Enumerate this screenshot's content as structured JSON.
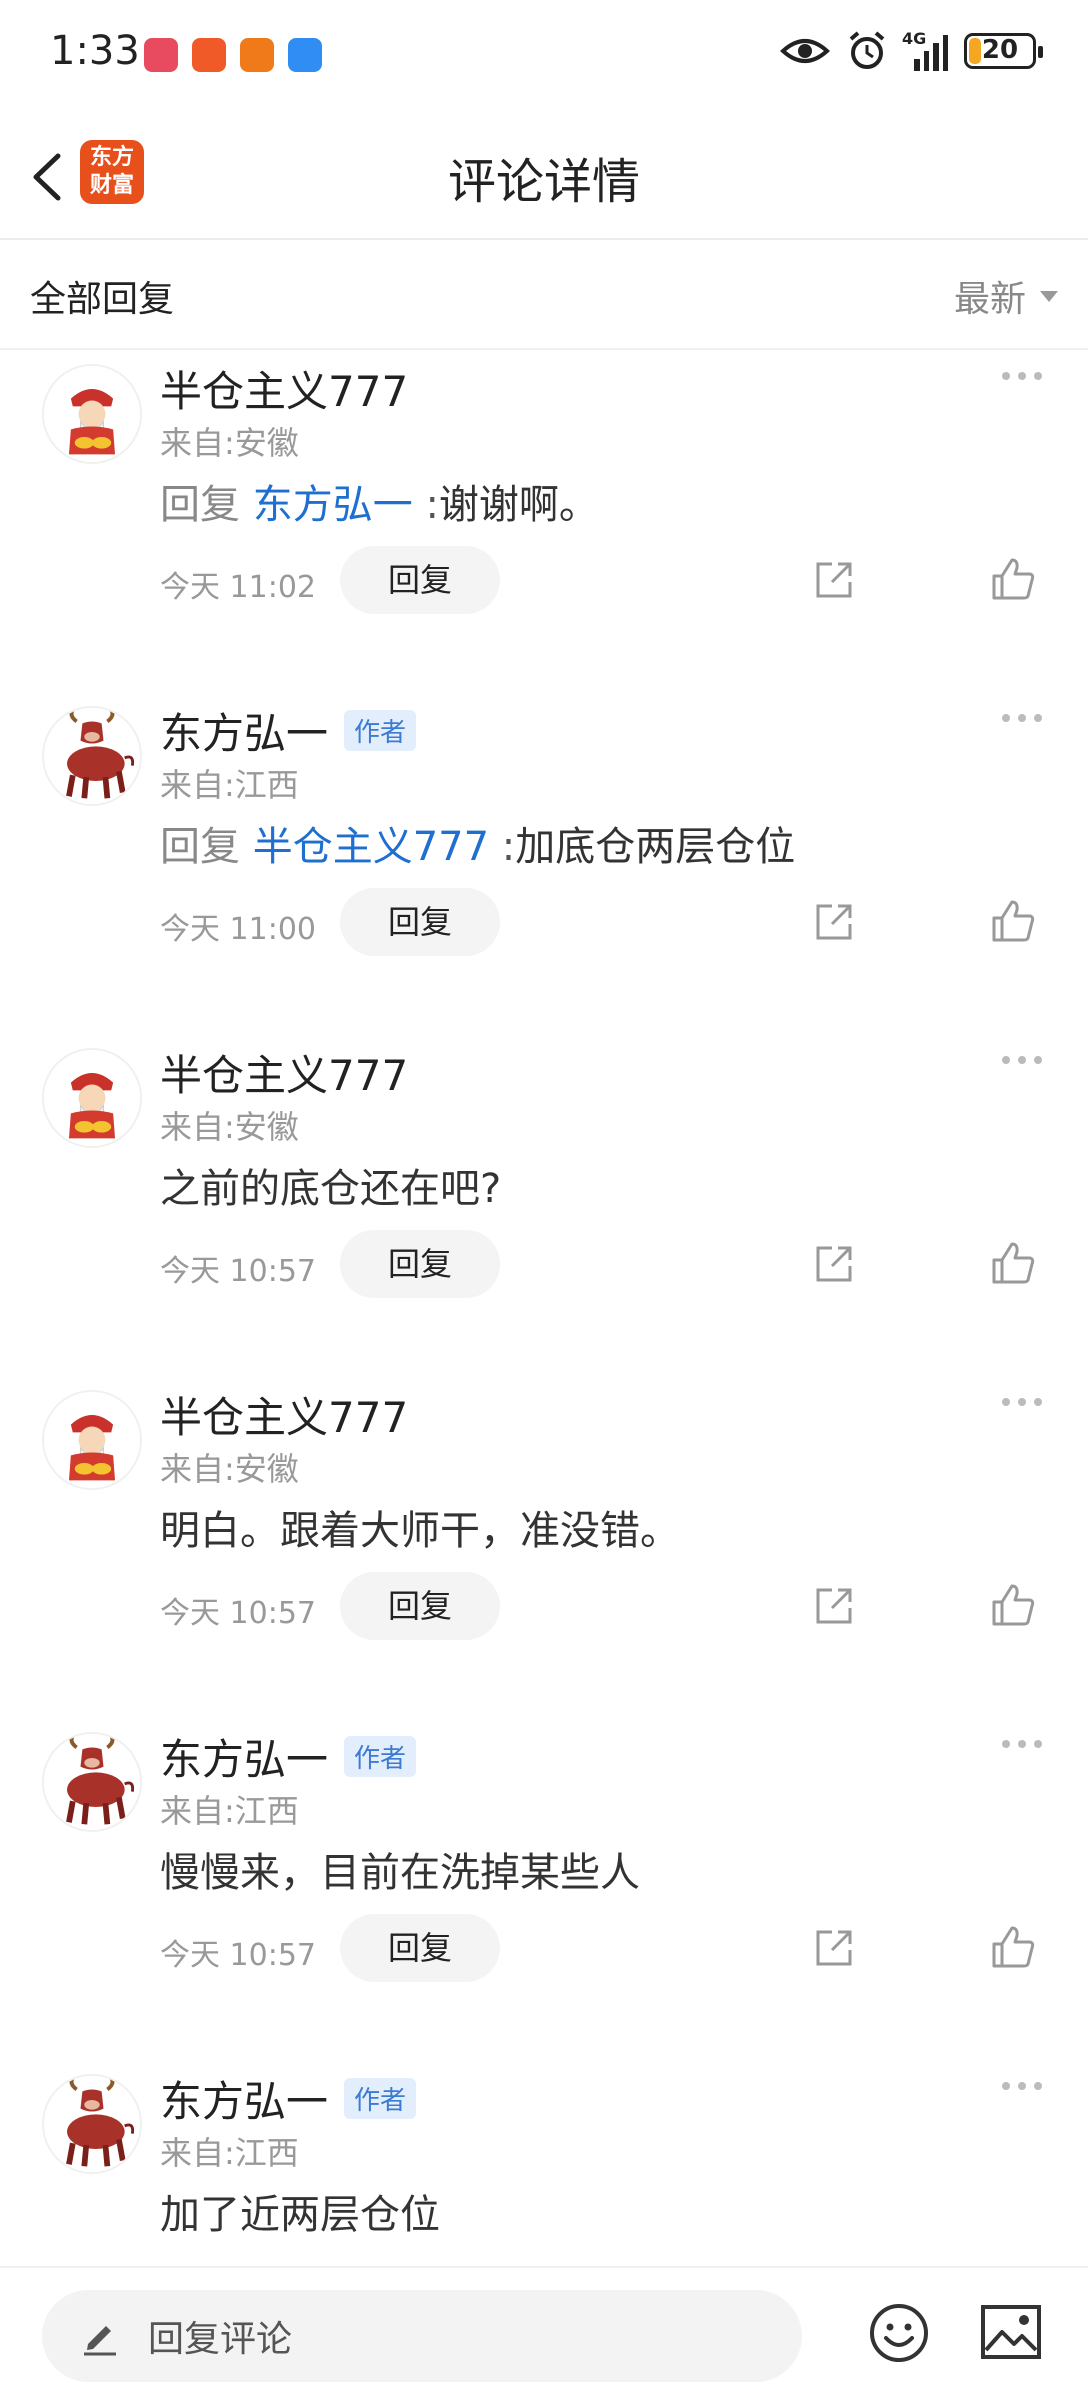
{
  "status_bar": {
    "time": "1:33",
    "network": "4G",
    "battery": "20",
    "battery_level": 0.2
  },
  "header": {
    "title": "评论详情",
    "logo_text": "东方财富"
  },
  "filter": {
    "label": "全部回复",
    "sort_label": "最新"
  },
  "comments": [
    {
      "username": "半仓主义777",
      "location": "来自:安徽",
      "reply_prefix": "回复",
      "reply_to": "东方弘一",
      "separator": ":",
      "text": "谢谢啊。",
      "time": "今天 11:02",
      "reply_label": "回复",
      "avatar": "fortune-god-avatar",
      "is_author": false
    },
    {
      "username": "东方弘一",
      "badge": "作者",
      "location": "来自:江西",
      "reply_prefix": "回复",
      "reply_to": "半仓主义777",
      "separator": ":",
      "text": "加底仓两层仓位",
      "time": "今天 11:00",
      "reply_label": "回复",
      "avatar": "bull-avatar",
      "is_author": true
    },
    {
      "username": "半仓主义777",
      "location": "来自:安徽",
      "text": "之前的底仓还在吧?",
      "time": "今天 10:57",
      "reply_label": "回复",
      "avatar": "fortune-god-avatar",
      "is_author": false
    },
    {
      "username": "半仓主义777",
      "location": "来自:安徽",
      "text": "明白。跟着大师干，准没错。",
      "time": "今天 10:57",
      "reply_label": "回复",
      "avatar": "fortune-god-avatar",
      "is_author": false
    },
    {
      "username": "东方弘一",
      "badge": "作者",
      "location": "来自:江西",
      "text": "慢慢来，目前在洗掉某些人",
      "time": "今天 10:57",
      "reply_label": "回复",
      "avatar": "bull-avatar",
      "is_author": true
    },
    {
      "username": "东方弘一",
      "badge": "作者",
      "location": "来自:江西",
      "text": "加了近两层仓位",
      "avatar": "bull-avatar",
      "is_author": true
    }
  ],
  "bottom_bar": {
    "placeholder": "回复评论"
  },
  "colors": {
    "link_blue": "#1e6fd0",
    "brand_orange": "#e8501b",
    "badge_bg": "#e3eefc"
  }
}
